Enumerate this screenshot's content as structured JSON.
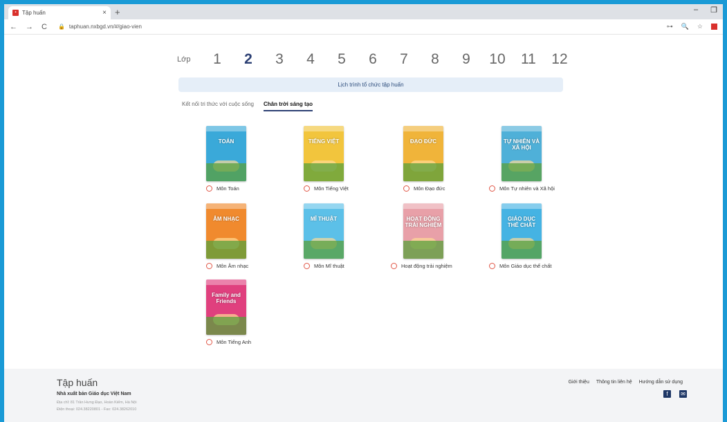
{
  "browser": {
    "tab_title": "Tập huấn",
    "tab_close": "×",
    "new_tab": "+",
    "win_min": "–",
    "win_restore": "❐",
    "back": "←",
    "forward": "→",
    "reload": "C",
    "url": "taphuan.nxbgd.vn/#/giao-vien",
    "key_icon": "⊶",
    "zoom_icon": "🔍",
    "star_icon": "☆"
  },
  "grade_selector": {
    "label": "Lớp",
    "grades": [
      "1",
      "2",
      "3",
      "4",
      "5",
      "6",
      "7",
      "8",
      "9",
      "10",
      "11",
      "12"
    ],
    "active_index": 1
  },
  "schedule_banner": "Lịch trình tổ chức tập huấn",
  "series_tabs": [
    "Kết nối tri thức với cuộc sống",
    "Chân trời sáng tạo"
  ],
  "active_series_index": 1,
  "books": [
    {
      "label": "Môn Toán",
      "cover_title": "TOÁN",
      "color": "#3aa9d9"
    },
    {
      "label": "Môn Tiếng Việt",
      "cover_title": "TIẾNG VIỆT",
      "color": "#f2c53d"
    },
    {
      "label": "Môn Đạo đức",
      "cover_title": "ĐẠO ĐỨC",
      "color": "#f0b43a"
    },
    {
      "label": "Môn Tự nhiên và Xã hội",
      "cover_title": "TỰ NHIÊN VÀ XÃ HỘI",
      "color": "#4fb0d8"
    },
    {
      "label": "Môn Âm nhạc",
      "cover_title": "ÂM NHẠC",
      "color": "#f08a2e"
    },
    {
      "label": "Môn Mĩ thuật",
      "cover_title": "MĨ THUẬT",
      "color": "#5cc0e8"
    },
    {
      "label": "Hoạt động trải nghiệm",
      "cover_title": "HOẠT ĐỘNG TRẢI NGHIỆM",
      "color": "#e8a0a8"
    },
    {
      "label": "Môn Giáo dục thể chất",
      "cover_title": "GIÁO DỤC THỂ CHẤT",
      "color": "#45b3e3"
    },
    {
      "label": "Môn Tiếng Anh",
      "cover_title": "Family and Friends",
      "color": "#e0407e"
    }
  ],
  "footer": {
    "title": "Tập huấn",
    "publisher": "Nhà xuất bản Giáo dục Việt Nam",
    "address": "Địa chỉ: 81 Trần Hưng Đạo, Hoàn Kiếm, Hà Nội",
    "phone": "Điện thoại: 024.38220801 - Fax: 024.38262010",
    "links": [
      "Giới thiệu",
      "Thông tin liên hệ",
      "Hướng dẫn sử dụng"
    ]
  }
}
